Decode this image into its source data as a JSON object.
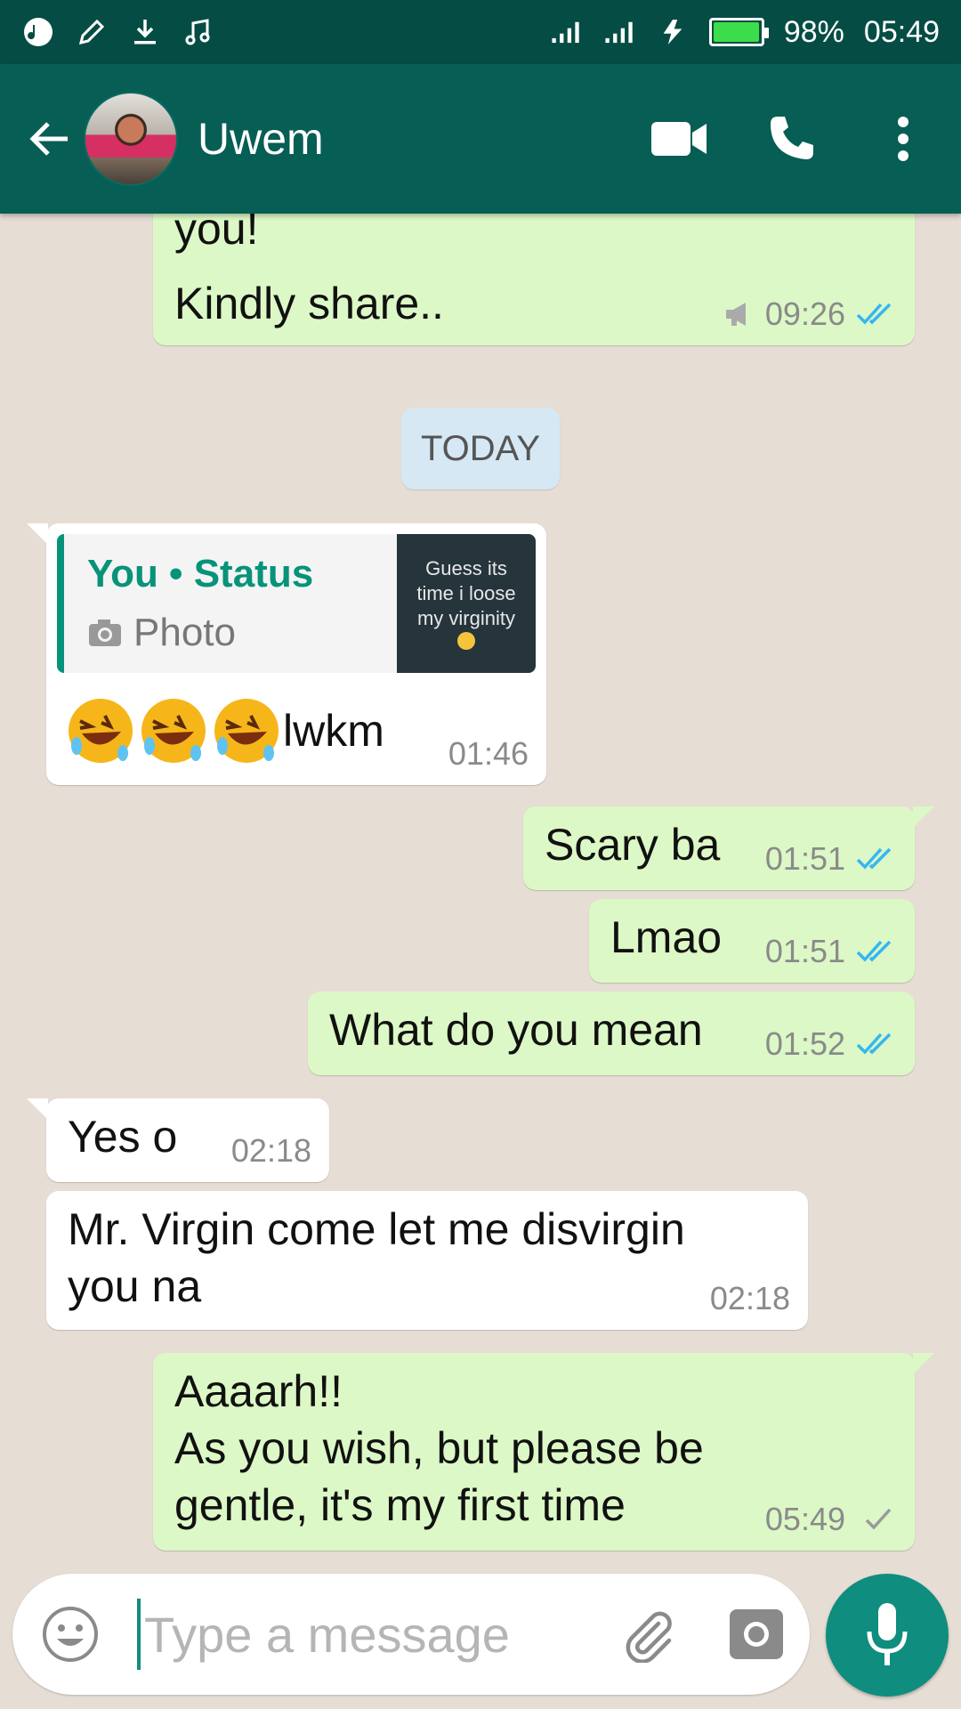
{
  "status_bar": {
    "battery": "98%",
    "time": "05:49",
    "battery_level": 0.98,
    "left_icons": [
      "whatsapp-icon",
      "edit-icon",
      "download-icon",
      "music-icon"
    ],
    "right_icons": [
      "signal-icon",
      "signal-icon",
      "flash-icon",
      "battery-icon"
    ]
  },
  "header": {
    "contact_name": "Uwem",
    "icons": [
      "back-arrow-icon",
      "video-call-icon",
      "phone-icon",
      "more-options-icon"
    ]
  },
  "date_separator": "TODAY",
  "messages": [
    {
      "direction": "outgoing",
      "text_line1": "you!",
      "text_line2": "Kindly share..",
      "time": "09:26",
      "status": "read",
      "extra_icon": "broadcast-icon"
    },
    {
      "direction": "incoming",
      "reply_to": {
        "author": "You • Status",
        "type": "Photo",
        "thumbnail_text": "Guess its time i loose my virginity"
      },
      "text": "lwkm",
      "emojis": [
        "rolling-on-floor-laughing",
        "rolling-on-floor-laughing",
        "rolling-on-floor-laughing"
      ],
      "time": "01:46"
    },
    {
      "direction": "outgoing",
      "text": "Scary ba",
      "time": "01:51",
      "status": "read"
    },
    {
      "direction": "outgoing",
      "text": "Lmao",
      "time": "01:51",
      "status": "read"
    },
    {
      "direction": "outgoing",
      "text": "What do you mean",
      "time": "01:52",
      "status": "read"
    },
    {
      "direction": "incoming",
      "text": "Yes o",
      "time": "02:18"
    },
    {
      "direction": "incoming",
      "text_line1": "Mr. Virgin come let me disvirgin",
      "text_line2": "you na",
      "time": "02:18"
    },
    {
      "direction": "outgoing",
      "text_line1": "Aaaarh!!",
      "text_line2": "As you wish, but please be",
      "text_line3": "gentle, it's my first time",
      "time": "05:49",
      "status": "sent"
    }
  ],
  "input": {
    "placeholder": "Type a message",
    "value": "",
    "icons": [
      "emoji-icon",
      "attach-icon",
      "camera-icon",
      "mic-icon"
    ]
  },
  "colors": {
    "header": "#075e54",
    "status_bar": "#054d44",
    "outgoing_bubble": "#dcf8c6",
    "incoming_bubble": "#ffffff",
    "accent": "#07937a",
    "read_tick": "#34b7f1",
    "background": "#e6ddd4"
  }
}
